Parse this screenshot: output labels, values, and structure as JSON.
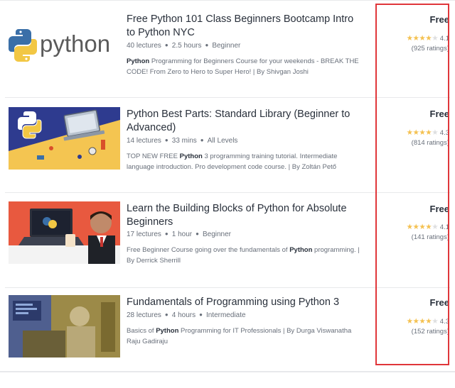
{
  "courses": [
    {
      "title": "Free Python 101 Class Beginners Bootcamp Intro to Python NYC",
      "lectures": "40 lectures",
      "duration": "2.5 hours",
      "level": "Beginner",
      "description_bold": "Python",
      "description_rest": " Programming for Beginners Course for your weekends - BREAK THE CODE! From Zero to Hero to Super Hero! | By Shivgan Joshi",
      "price": "Free",
      "rating": "4.1",
      "ratings_count": "(925 ratings)",
      "thumb_text": "python",
      "stars": 4.1
    },
    {
      "title": "Python Best Parts: Standard Library (Beginner to Advanced)",
      "lectures": "14 lectures",
      "duration": "33 mins",
      "level": "All Levels",
      "description_pre": "TOP NEW FREE ",
      "description_bold": "Python",
      "description_rest": " 3 programming training tutorial. Intermediate language introduction. Pro development code course. | By Zoltán Pető",
      "price": "Free",
      "rating": "4.3",
      "ratings_count": "(814 ratings)",
      "stars": 4.3
    },
    {
      "title": "Learn the Building Blocks of Python for Absolute Beginners",
      "lectures": "17 lectures",
      "duration": "1 hour",
      "level": "Beginner",
      "description_pre": "Free Beginner Course going over the fundamentals of ",
      "description_bold": "Python",
      "description_rest": " programming. | By Derrick Sherrill",
      "price": "Free",
      "rating": "4.1",
      "ratings_count": "(141 ratings)",
      "stars": 4.1
    },
    {
      "title": "Fundamentals of Programming using Python 3",
      "lectures": "28 lectures",
      "duration": "4 hours",
      "level": "Intermediate",
      "description_pre": "Basics of ",
      "description_bold": "Python",
      "description_rest": " Programming for IT Professionals | By Durga Viswanatha Raju Gadiraju",
      "price": "Free",
      "rating": "4.3",
      "ratings_count": "(152 ratings)",
      "stars": 4.3
    }
  ],
  "colors": {
    "highlight_border": "#e0363a",
    "star_filled": "#f4c150",
    "star_empty": "#dedfe0",
    "python_blue": "#3a6fa8",
    "python_yellow": "#f2c744"
  },
  "icons": {
    "star": "star-icon",
    "bullet": "bullet-icon"
  }
}
